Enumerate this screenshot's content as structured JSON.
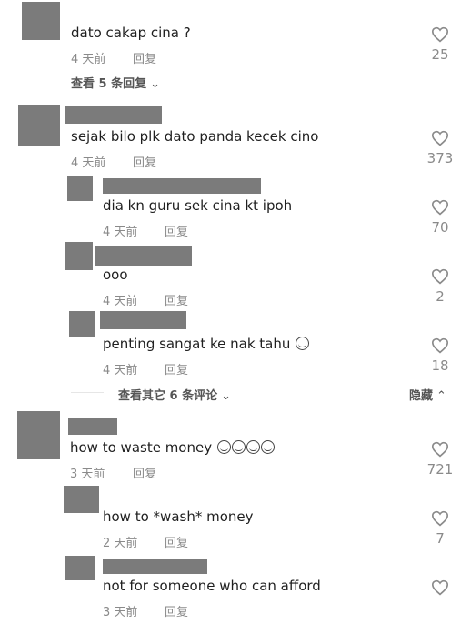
{
  "comments": [
    {
      "text": "dato cakap cina ?",
      "time": "4 天前",
      "reply": "回复",
      "likes": "25"
    },
    {
      "text": "sejak bilo plk dato panda kecek cino",
      "time": "4 天前",
      "reply": "回复",
      "likes": "373"
    },
    {
      "text": "dia kn guru sek cina kt ipoh",
      "time": "4 天前",
      "reply": "回复",
      "likes": "70"
    },
    {
      "text": "ooo",
      "time": "4 天前",
      "reply": "回复",
      "likes": "2"
    },
    {
      "text": "penting sangat ke nak tahu",
      "time": "4 天前",
      "reply": "回复",
      "likes": "18"
    },
    {
      "text": "how to waste money",
      "time": "3 天前",
      "reply": "回复",
      "likes": "721"
    },
    {
      "text": "how to *wash* money",
      "time": "2 天前",
      "reply": "回复",
      "likes": "7"
    },
    {
      "text": "not for someone who can afford",
      "time": "3 天前",
      "reply": "回复",
      "likes": ""
    }
  ],
  "view_replies_1": "查看 5 条回复",
  "view_more_2": "查看其它 6 条评论",
  "hide_label": "隐藏",
  "icons": {
    "like": "heart-outline-icon",
    "chevron_down": "chevron-down-icon",
    "chevron_up": "chevron-up-icon",
    "emoji": "laughing-emoji-icon"
  }
}
